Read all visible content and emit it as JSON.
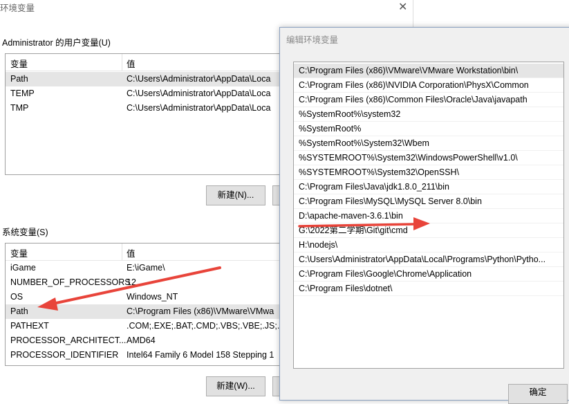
{
  "back": {
    "title": "环境变量",
    "user_group_label": "Administrator 的用户变量(U)",
    "user_headers": [
      "变量",
      "值"
    ],
    "user_rows": [
      {
        "name": "Path",
        "value": "C:\\Users\\Administrator\\AppData\\Loca"
      },
      {
        "name": "TEMP",
        "value": "C:\\Users\\Administrator\\AppData\\Loca"
      },
      {
        "name": "TMP",
        "value": "C:\\Users\\Administrator\\AppData\\Loca"
      }
    ],
    "user_new_button": "新建(N)...",
    "sys_group_label": "系统变量(S)",
    "sys_headers": [
      "变量",
      "值"
    ],
    "sys_rows": [
      {
        "name": "iGame",
        "value": "E:\\iGame\\"
      },
      {
        "name": "NUMBER_OF_PROCESSORS",
        "value": "12"
      },
      {
        "name": "OS",
        "value": "Windows_NT"
      },
      {
        "name": "Path",
        "value": "C:\\Program Files (x86)\\VMware\\VMwa"
      },
      {
        "name": "PATHEXT",
        "value": ".COM;.EXE;.BAT;.CMD;.VBS;.VBE;.JS;.JSE"
      },
      {
        "name": "PROCESSOR_ARCHITECT...",
        "value": "AMD64"
      },
      {
        "name": "PROCESSOR_IDENTIFIER",
        "value": "Intel64 Family 6 Model 158 Stepping 1"
      }
    ],
    "sys_new_button": "新建(W)..."
  },
  "front": {
    "title": "编辑环境变量",
    "paths": [
      "C:\\Program Files (x86)\\VMware\\VMware Workstation\\bin\\",
      "C:\\Program Files (x86)\\NVIDIA Corporation\\PhysX\\Common",
      "C:\\Program Files (x86)\\Common Files\\Oracle\\Java\\javapath",
      "%SystemRoot%\\system32",
      "%SystemRoot%",
      "%SystemRoot%\\System32\\Wbem",
      "%SYSTEMROOT%\\System32\\WindowsPowerShell\\v1.0\\",
      "%SYSTEMROOT%\\System32\\OpenSSH\\",
      "C:\\Program Files\\Java\\jdk1.8.0_211\\bin",
      "C:\\Program Files\\MySQL\\MySQL Server 8.0\\bin",
      "D:\\apache-maven-3.6.1\\bin",
      "G:\\2022第二学期\\Git\\git\\cmd",
      "H:\\nodejs\\",
      "C:\\Users\\Administrator\\AppData\\Local\\Programs\\Python\\Pytho...",
      "C:\\Program Files\\Google\\Chrome\\Application",
      "C:\\Program Files\\dotnet\\"
    ],
    "ok_button": "确定"
  },
  "colors": {
    "arrow": "#e8443a"
  }
}
